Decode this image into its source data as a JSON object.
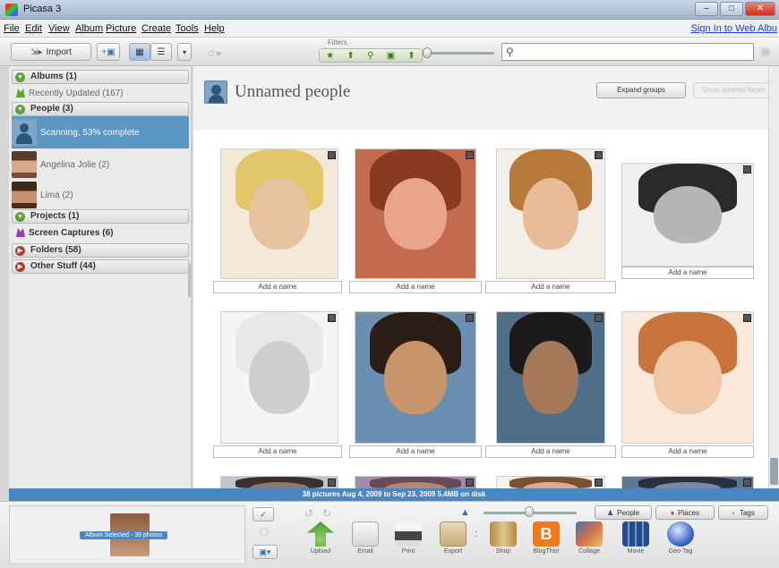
{
  "window": {
    "title": "Picasa 3",
    "buttons": [
      "–",
      "□",
      "✕"
    ]
  },
  "menu": {
    "items": [
      "File",
      "Edit",
      "View",
      "Album",
      "Picture",
      "Create",
      "Tools",
      "Help"
    ],
    "signin": "Sign In to Web Albu"
  },
  "toolbar": {
    "import_label": "Import",
    "filters_label": "Filters",
    "search_placeholder": ""
  },
  "sidebar": {
    "albums_header": "Albums (1)",
    "recently_updated": "Recently Updated (167)",
    "people_header": "People (3)",
    "scanning": "Scanning, 53% complete",
    "person1": "Angelina Jolie (2)",
    "person2": "Lima (2)",
    "projects_header": "Projects (1)",
    "screen_captures": "Screen Captures (6)",
    "folders_header": "Folders (58)",
    "other_header": "Other Stuff (44)"
  },
  "main": {
    "title": "Unnamed people",
    "expand_label": "Expand groups",
    "ignored_label": "Show ignored faces",
    "name_placeholder": "Add a name"
  },
  "faces": [
    {
      "skin": "#e9c2a0",
      "hair": "#e3c56a",
      "bg": "#f4e8d8"
    },
    {
      "skin": "#e8a58c",
      "hair": "#8a3a22",
      "bg": "#c56b4f"
    },
    {
      "skin": "#e8bc98",
      "hair": "#b87a3a",
      "bg": "#f3eee8"
    },
    {
      "skin": "#b5b5b5",
      "hair": "#2a2a2a",
      "bg": "#efefef"
    },
    {
      "skin": "#cfcfcf",
      "hair": "#e8e8e8",
      "bg": "#f5f5f5"
    },
    {
      "skin": "#c8946c",
      "hair": "#2a1e16",
      "bg": "#6b8fb0"
    },
    {
      "skin": "#a6785a",
      "hair": "#1c1a1a",
      "bg": "#4f6e88"
    },
    {
      "skin": "#f0c8a8",
      "hair": "#c8743c",
      "bg": "#fbe9dc"
    },
    {
      "skin": "#8a7a70",
      "hair": "#3a3030",
      "bg": "#c0c4cc"
    },
    {
      "skin": "#b28878",
      "hair": "#6a4a5a",
      "bg": "#a48ab0"
    },
    {
      "skin": "#d8b090",
      "hair": "#7a5030",
      "bg": "#f6f2ee"
    },
    {
      "skin": "#7a8aa0",
      "hair": "#2a3040",
      "bg": "#5a7894"
    }
  ],
  "status": "38 pictures    Aug 4, 2009 to Sep 23, 2009    5.4MB on disk",
  "bottom": {
    "tray_label": "Album Selected - 38 photos",
    "actions": [
      "Upload",
      "Email",
      "Print",
      "Export",
      "Shop",
      "BlogThis!",
      "Collage",
      "Movie",
      "Geo-Tag"
    ],
    "tags": [
      "People",
      "Places",
      "Tags"
    ]
  },
  "colors": {
    "accent": "#4a87c1",
    "selected": "#5b97c3"
  }
}
